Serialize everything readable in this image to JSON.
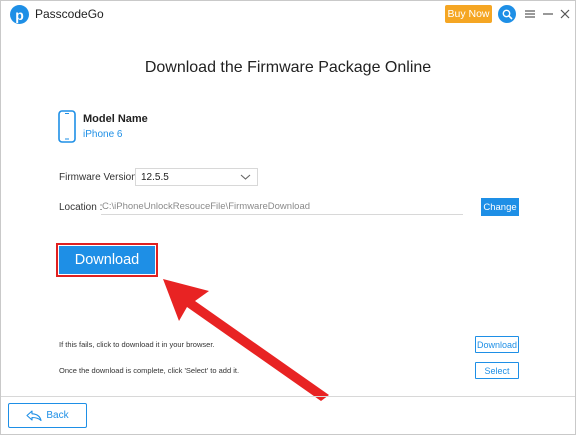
{
  "app": {
    "title": "PasscodeGo",
    "logo_letter": "p",
    "buy_label": "Buy Now"
  },
  "icons": {
    "logo": "passcodego-logo-icon",
    "help": "search-help-icon",
    "menu": "hamburger-menu-icon",
    "minimize": "minimize-icon",
    "close": "close-icon",
    "phone": "iphone-icon",
    "chevron": "chevron-down-icon",
    "back": "back-arrow-icon"
  },
  "colors": {
    "accent": "#1e8fe6",
    "buy": "#f5a623",
    "highlight": "#e02020"
  },
  "main": {
    "heading": "Download the Firmware Package Online",
    "model_label": "Model Name",
    "model_value": "iPhone 6",
    "firmware_label": "Firmware Version:",
    "firmware_value": "12.5.5",
    "location_label": "Location :",
    "location_path": "C:\\iPhoneUnlockResouceFile\\FirmwareDownload",
    "change_label": "Change",
    "download_label": "Download"
  },
  "hints": {
    "fail_text": "If this fails, click to download it in your browser.",
    "fail_button": "Download",
    "complete_text": "Once the download is complete, click 'Select' to add it.",
    "complete_button": "Select"
  },
  "footer": {
    "back_label": "Back"
  }
}
